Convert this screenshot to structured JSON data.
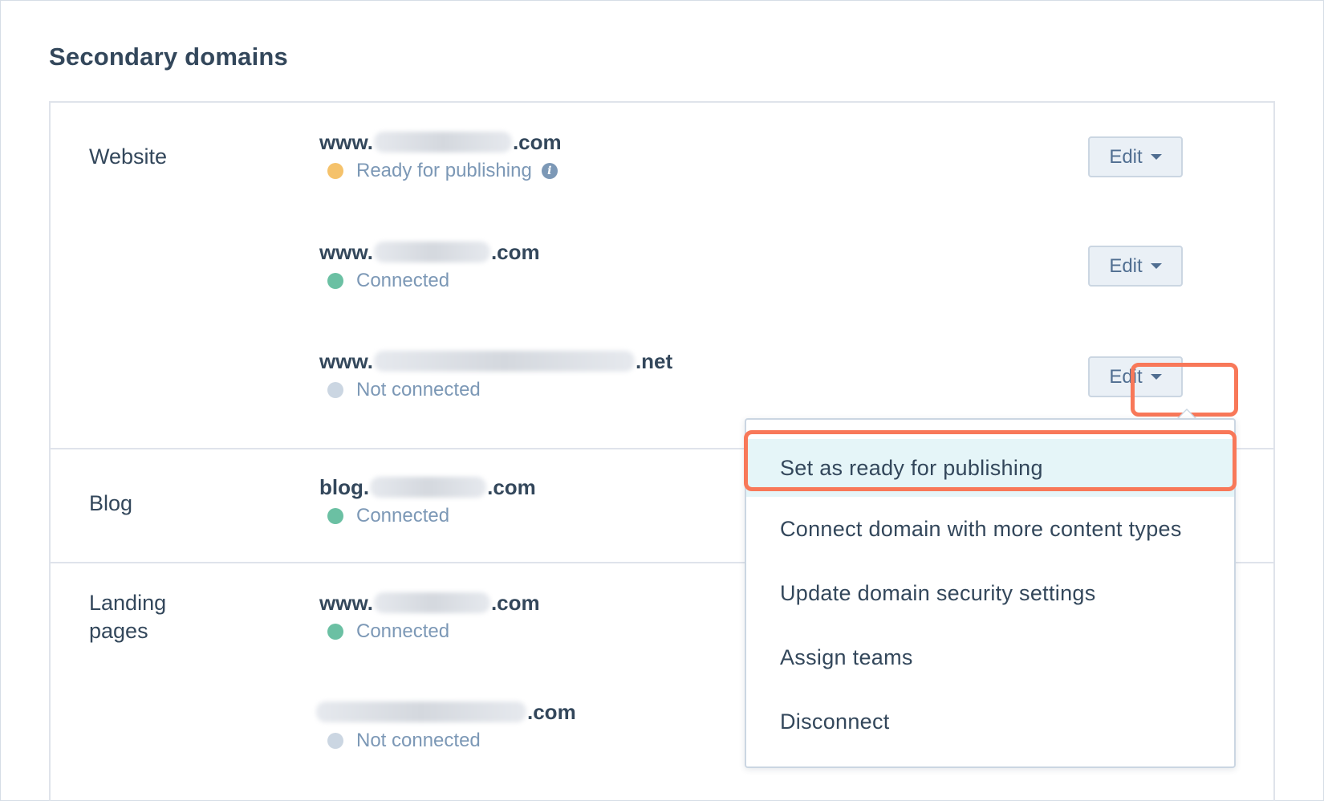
{
  "page": {
    "title": "Secondary domains"
  },
  "colors": {
    "status_ready": "#f5c26b",
    "status_connected": "#00a4bd",
    "status_connected_dot": "#6bc0a3",
    "status_not_connected": "#cbd6e2",
    "highlight": "#f87859",
    "active_menu_bg": "#e5f5f8"
  },
  "groups": [
    {
      "label": "Website",
      "domains": [
        {
          "prefix": "www.",
          "suffix": ".com",
          "status": "Ready for publishing",
          "status_type": "ready",
          "has_info_icon": true,
          "edit_label": "Edit"
        },
        {
          "prefix": "www.",
          "suffix": ".com",
          "status": "Connected",
          "status_type": "connected",
          "edit_label": "Edit"
        },
        {
          "prefix": "www.",
          "suffix": ".net",
          "status": "Not connected",
          "status_type": "not-connected",
          "edit_label": "Edit",
          "menu_open": true
        }
      ]
    },
    {
      "label": "Blog",
      "domains": [
        {
          "prefix": "blog.",
          "suffix": ".com",
          "status": "Connected",
          "status_type": "connected"
        }
      ]
    },
    {
      "label": "Landing pages",
      "label_line1": "Landing",
      "label_line2": "pages",
      "domains": [
        {
          "prefix": "www.",
          "suffix": ".com",
          "status": "Connected",
          "status_type": "connected"
        },
        {
          "prefix": "",
          "suffix": ".com",
          "status": "Not connected",
          "status_type": "not-connected"
        }
      ]
    }
  ],
  "edit_menu": {
    "items": [
      {
        "label": "Set as ready for publishing",
        "active": true
      },
      {
        "label": "Connect domain with more content types"
      },
      {
        "label": "Update domain security settings"
      },
      {
        "label": "Assign teams"
      },
      {
        "label": "Disconnect"
      }
    ]
  }
}
